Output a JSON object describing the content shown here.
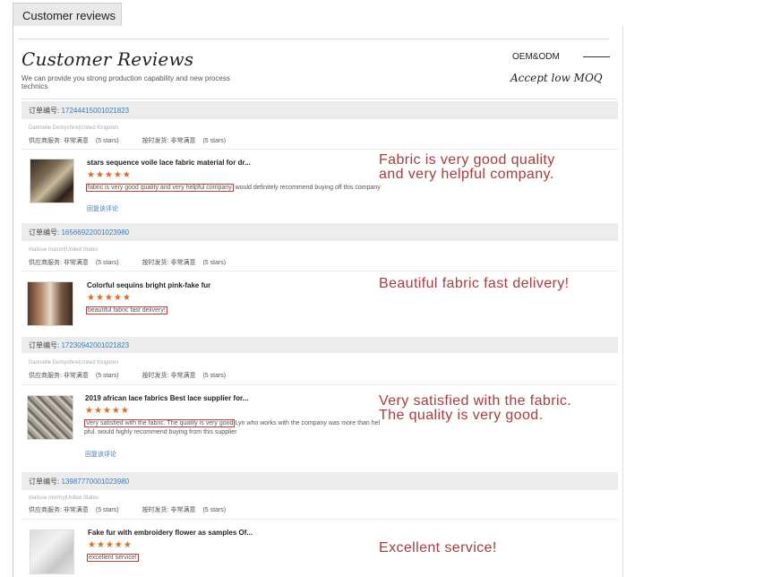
{
  "tab_label": "Customer reviews",
  "header": {
    "title": "Customer Reviews",
    "subtitle": "We can provide you strong production capability and new process technics",
    "oem": "OEM&ODM",
    "moq": "Accept low MOQ"
  },
  "labels": {
    "order_prefix": "订单编号:",
    "supplier_service": "供应商服务: 非常满意",
    "on_time": "按时发货: 非常满意",
    "stars_text": "(5 stars)",
    "reply": "回复该评论"
  },
  "reviews": [
    {
      "order_no": "17244415001021823",
      "buyer": "Dannielle Derbyshire|United Kingdom",
      "product": "stars sequence voile lace fabric material for dr...",
      "stars": "★★★★★",
      "highlight": "fabric is very good quality and very helpful company",
      "rest": "would definitely recommend buying off this company",
      "rest2": "",
      "caption1": "Fabric is very good quality",
      "caption2": "and very helpful company."
    },
    {
      "order_no": "16566922001023980",
      "buyer": "malisse mason|United States",
      "product": "Colorful sequins bright pink-fake fur",
      "stars": "★★★★★",
      "highlight": "beautiful fabric fast delivery!",
      "rest": "",
      "rest2": "",
      "caption1": "Beautiful fabric fast delivery!",
      "caption2": ""
    },
    {
      "order_no": "17230942001021823",
      "buyer": "Dannielle Derbyshire|United Kingdom",
      "product": "2019 african lace fabrics Best lace supplier for...",
      "stars": "★★★★★",
      "highlight": "Very satisfied with the fabric. The quality is very good",
      "rest": "Lyn who works with the company was more than hel",
      "rest2": "pful. would highly recommend buying from this supplier",
      "caption1": "Very satisfied with the fabric.",
      "caption2": "The quality is very good."
    },
    {
      "order_no": "13987770001023980",
      "buyer": "malisse mormy|United States",
      "product": "Fake fur with embroidery flower as samples Of...",
      "stars": "★★★★★",
      "highlight": "excellent service!",
      "rest": "",
      "rest2": "",
      "caption1": "Excellent service!",
      "caption2": ""
    }
  ]
}
